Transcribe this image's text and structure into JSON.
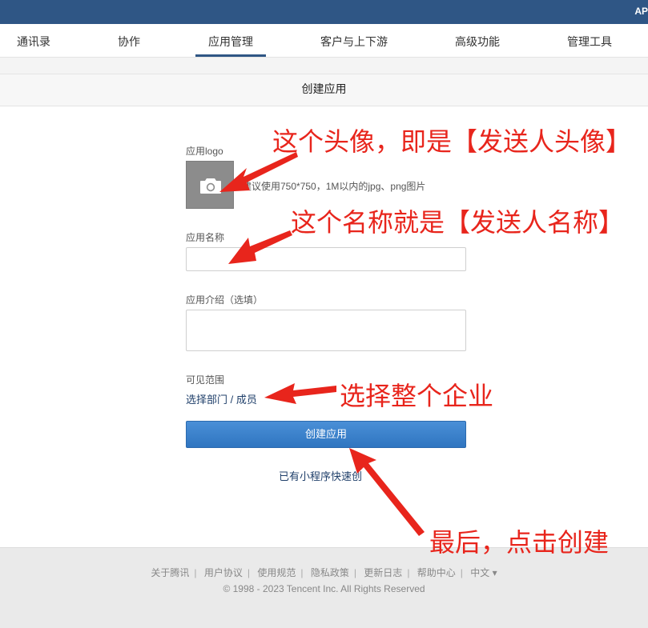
{
  "topbar": {
    "right_text": "AP"
  },
  "nav": {
    "tabs": [
      {
        "label": "通讯录"
      },
      {
        "label": "协作"
      },
      {
        "label": "应用管理"
      },
      {
        "label": "客户与上下游"
      },
      {
        "label": "高级功能"
      },
      {
        "label": "管理工具"
      }
    ],
    "active_index": 2
  },
  "page": {
    "title": "创建应用"
  },
  "form": {
    "logo_label": "应用logo",
    "logo_hint": "建议使用750*750，1M以内的jpg、png图片",
    "name_label": "应用名称",
    "name_value": "",
    "intro_label": "应用介绍（选填）",
    "intro_value": "",
    "scope_label": "可见范围",
    "scope_link": "选择部门 / 成员",
    "submit_label": "创建应用",
    "mini_program_link": "已有小程序快速创"
  },
  "footer": {
    "links": [
      "关于腾讯",
      "用户协议",
      "使用规范",
      "隐私政策",
      "更新日志",
      "帮助中心"
    ],
    "language": "中文 ▾",
    "copyright": "© 1998 - 2023 Tencent Inc. All Rights Reserved"
  },
  "annotations": {
    "avatar_note": "这个头像，即是【发送人头像】",
    "name_note": "这个名称就是【发送人名称】",
    "scope_note": "选择整个企业",
    "create_note": "最后，点击创建"
  },
  "colors": {
    "topbar": "#2f5685",
    "button": "#3a82cc",
    "annotation": "#e8251c",
    "link": "#1f3f6a"
  }
}
